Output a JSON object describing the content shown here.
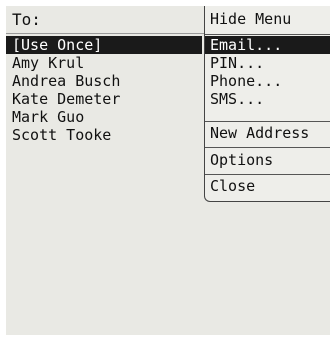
{
  "header": {
    "to_label": "To:"
  },
  "contacts": [
    {
      "label": "[Use Once]",
      "selected": true
    },
    {
      "label": "Amy Krul",
      "selected": false
    },
    {
      "label": "Andrea Busch",
      "selected": false
    },
    {
      "label": "Kate Demeter",
      "selected": false
    },
    {
      "label": "Mark Guo",
      "selected": false
    },
    {
      "label": "Scott Tooke",
      "selected": false
    }
  ],
  "menu": {
    "items": [
      {
        "label": "Hide Menu"
      },
      {
        "label": "Email...",
        "selected": true
      },
      {
        "label": "PIN..."
      },
      {
        "label": "Phone..."
      },
      {
        "label": "SMS..."
      },
      {
        "label": "New Address"
      },
      {
        "label": "Options"
      },
      {
        "label": "Close"
      }
    ]
  },
  "colors": {
    "screen_background": "#e9e9e4",
    "highlight": "#1a1a1a",
    "highlight_text": "#ffffff"
  }
}
